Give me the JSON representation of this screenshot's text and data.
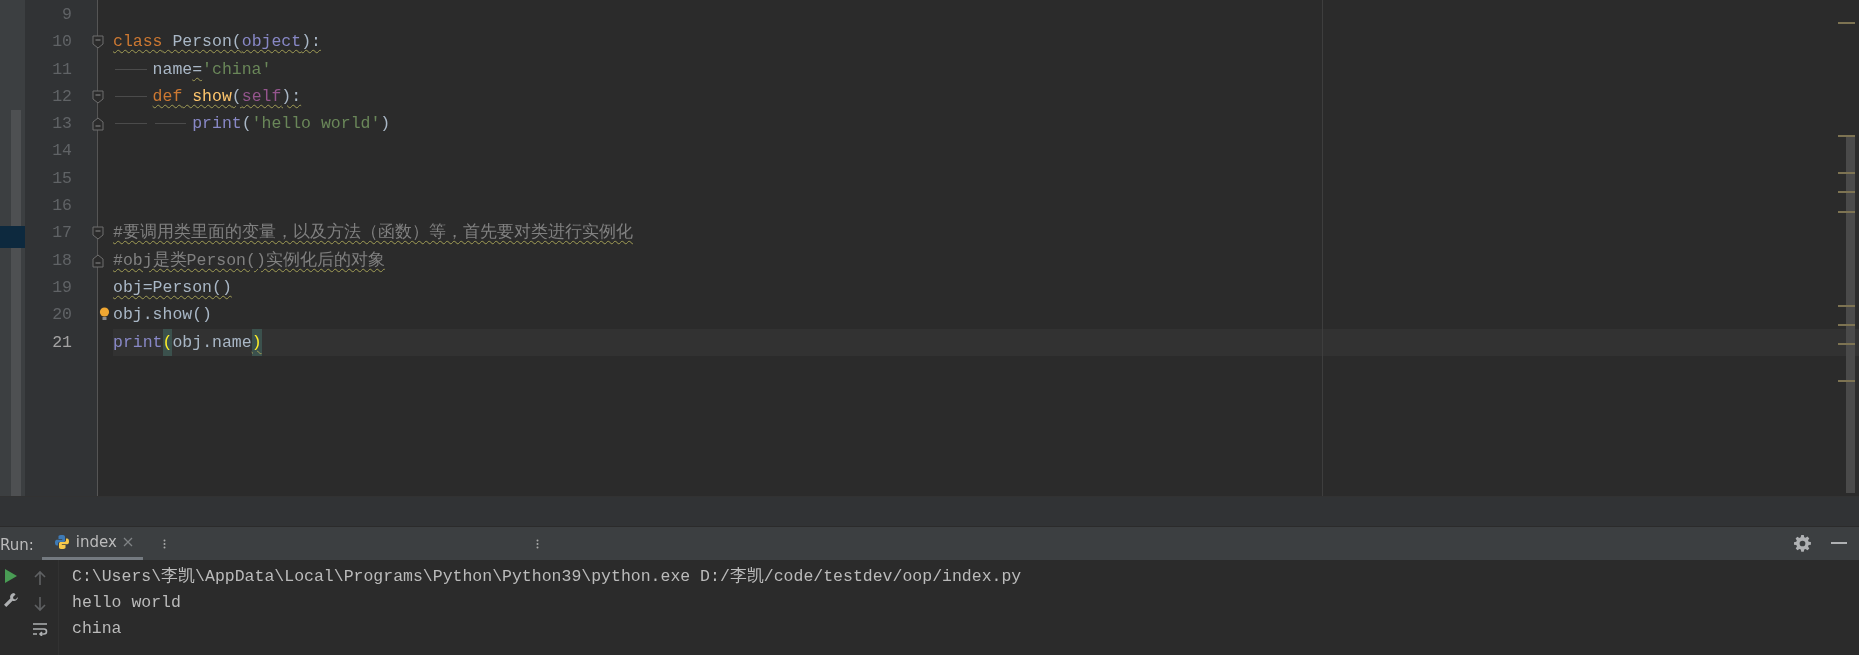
{
  "editor": {
    "lines": [
      {
        "number": "9",
        "current": false,
        "fold_opens": false,
        "fold_closes": false,
        "lightbulb": false
      },
      {
        "number": "10",
        "current": false,
        "fold_opens": true,
        "fold_closes": false,
        "lightbulb": false,
        "tokens": [
          {
            "text": "class",
            "kind": "keyword",
            "wavy": true
          },
          {
            "text": " Person(",
            "kind": "plain",
            "wavy": true
          },
          {
            "text": "object",
            "kind": "builtin",
            "wavy": true
          },
          {
            "text": "):",
            "kind": "plain",
            "wavy": true
          }
        ]
      },
      {
        "number": "11",
        "current": false,
        "fold_opens": false,
        "fold_closes": false,
        "lightbulb": false,
        "tokens": [
          {
            "text": "    name",
            "kind": "plain",
            "wavy": false
          },
          {
            "text": "=",
            "kind": "plain",
            "wavy": true
          },
          {
            "text": "'china'",
            "kind": "string",
            "wavy": false
          }
        ]
      },
      {
        "number": "12",
        "current": false,
        "fold_opens": true,
        "fold_closes": false,
        "lightbulb": false,
        "tokens": [
          {
            "text": "    def",
            "kind": "keyword",
            "wavy": true
          },
          {
            "text": " show",
            "kind": "function",
            "wavy": true
          },
          {
            "text": "(",
            "kind": "plain",
            "wavy": true
          },
          {
            "text": "self",
            "kind": "self",
            "wavy": true
          },
          {
            "text": "):",
            "kind": "plain",
            "wavy": true
          }
        ]
      },
      {
        "number": "13",
        "current": false,
        "fold_opens": false,
        "fold_closes": true,
        "lightbulb": false,
        "tokens": [
          {
            "text": "        print",
            "kind": "builtin",
            "wavy": false
          },
          {
            "text": "(",
            "kind": "plain",
            "wavy": false
          },
          {
            "text": "'hello world'",
            "kind": "string",
            "wavy": false
          },
          {
            "text": ")",
            "kind": "plain",
            "wavy": false
          }
        ]
      },
      {
        "number": "14",
        "current": false,
        "fold_opens": false,
        "fold_closes": false,
        "lightbulb": false
      },
      {
        "number": "15",
        "current": false,
        "fold_opens": false,
        "fold_closes": false,
        "lightbulb": false
      },
      {
        "number": "16",
        "current": false,
        "fold_opens": false,
        "fold_closes": false,
        "lightbulb": false
      },
      {
        "number": "17",
        "current": false,
        "fold_opens": true,
        "fold_closes": false,
        "lightbulb": false,
        "tokens": [
          {
            "text": "#要调用类里面的变量，以及方法（函数）等，首先要对类进行实例化",
            "kind": "comment",
            "wavy": true
          }
        ]
      },
      {
        "number": "18",
        "current": false,
        "fold_opens": false,
        "fold_closes": true,
        "lightbulb": false,
        "tokens": [
          {
            "text": "#obj是类Person()实例化后的对象",
            "kind": "comment",
            "wavy": true
          }
        ]
      },
      {
        "number": "19",
        "current": false,
        "fold_opens": false,
        "fold_closes": false,
        "lightbulb": false,
        "tokens": [
          {
            "text": "obj=Person()",
            "kind": "plain",
            "wavy": true
          }
        ]
      },
      {
        "number": "20",
        "current": false,
        "fold_opens": false,
        "fold_closes": false,
        "lightbulb": true,
        "tokens": [
          {
            "text": "obj.show()",
            "kind": "plain",
            "wavy": false
          }
        ]
      },
      {
        "number": "21",
        "current": true,
        "fold_opens": false,
        "fold_closes": false,
        "lightbulb": false,
        "tokens": [
          {
            "text": "print",
            "kind": "builtin",
            "wavy": false
          },
          {
            "text": "(",
            "kind": "brace",
            "wavy": false
          },
          {
            "text": "obj.name",
            "kind": "plain",
            "wavy": false
          },
          {
            "text": ")",
            "kind": "brace",
            "wavy": true
          }
        ]
      }
    ]
  },
  "run_panel": {
    "label": "Run:",
    "tabs": [
      {
        "label": "index",
        "selected": true
      }
    ],
    "console": [
      "C:\\Users\\李凯\\AppData\\Local\\Programs\\Python\\Python39\\python.exe D:/李凯/code/testdev/oop/index.py",
      "hello world",
      "china"
    ]
  }
}
